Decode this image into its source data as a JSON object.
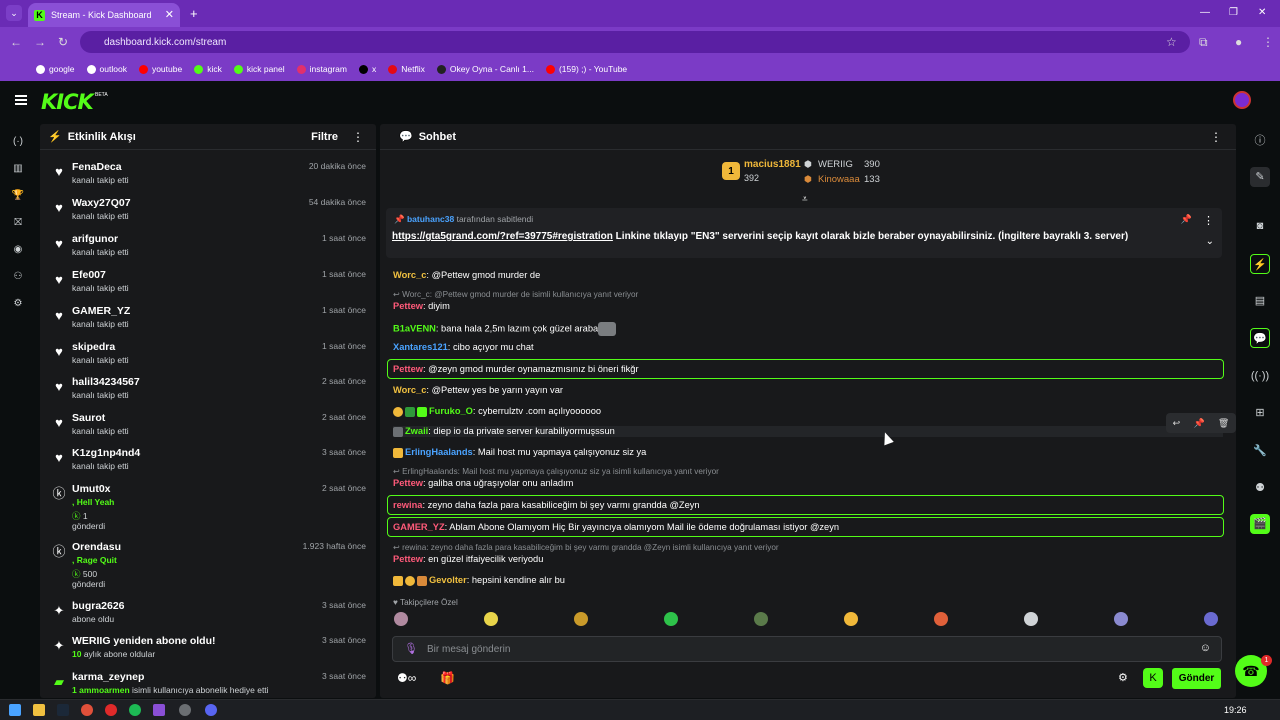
{
  "browser": {
    "tab_title": "Stream - Kick Dashboard",
    "new_tab": "+",
    "url": "dashboard.kick.com/stream",
    "bookmarks": [
      {
        "label": "google",
        "color": "#ffffff"
      },
      {
        "label": "outlook",
        "color": "#ffffff"
      },
      {
        "label": "youtube",
        "color": "#ff0000"
      },
      {
        "label": "kick",
        "color": "#53fc18"
      },
      {
        "label": "kick panel",
        "color": "#53fc18"
      },
      {
        "label": "instagram",
        "color": "#e1306c"
      },
      {
        "label": "x",
        "color": "#000000"
      },
      {
        "label": "Netflix",
        "color": "#e50914"
      },
      {
        "label": "Okey Oyna - Canlı 1...",
        "color": "#222222"
      },
      {
        "label": "(159) ;) - YouTube",
        "color": "#ff0000"
      }
    ]
  },
  "brand": {
    "logo": "KICK",
    "tag": "BETA",
    "accent": "#53fc18"
  },
  "activity": {
    "title": "Etkinlik Akışı",
    "filter_label": "Filtre",
    "items": [
      {
        "user": "FenaDeca",
        "sub": "kanalı takip etti",
        "time": "20 dakika önce",
        "icon": "heart-icon"
      },
      {
        "user": "Waxy27Q07",
        "sub": "kanalı takip etti",
        "time": "54 dakika önce",
        "icon": "heart-icon"
      },
      {
        "user": "arifgunor",
        "sub": "kanalı takip etti",
        "time": "1 saat önce",
        "icon": "heart-icon"
      },
      {
        "user": "Efe007",
        "sub": "kanalı takip etti",
        "time": "1 saat önce",
        "icon": "heart-icon"
      },
      {
        "user": "GAMER_YZ",
        "sub": "kanalı takip etti",
        "time": "1 saat önce",
        "icon": "heart-icon"
      },
      {
        "user": "skipedra",
        "sub": "kanalı takip etti",
        "time": "1 saat önce",
        "icon": "heart-icon"
      },
      {
        "user": "halil34234567",
        "sub": "kanalı takip etti",
        "time": "2 saat önce",
        "icon": "heart-icon"
      },
      {
        "user": "Saurot",
        "sub": "kanalı takip etti",
        "time": "2 saat önce",
        "icon": "heart-icon"
      },
      {
        "user": "K1zg1np4nd4",
        "sub": "kanalı takip etti",
        "time": "3 saat önce",
        "icon": "heart-icon"
      }
    ],
    "kicks": [
      {
        "user": "Umut0x",
        "extra": ", Hell Yeah",
        "amount": "1",
        "sub": "gönderdi",
        "time": "2 saat önce"
      },
      {
        "user": "Orendasu",
        "extra": ", Rage Quit",
        "amount": "500",
        "sub": "gönderdi",
        "time": "1.923 hafta önce"
      }
    ],
    "subs": [
      {
        "user": "bugra2626",
        "sub": "abone oldu",
        "time": "3 saat önce"
      },
      {
        "user": "WERIIG yeniden abone oldu!",
        "sub_green": "10",
        "sub": " aylık abone oldular",
        "time": "3 saat önce"
      },
      {
        "user": "karma_zeynep",
        "sub_green": "1",
        "sub_name": " ammoarmen",
        "sub": " isimli kullanıcıya abonelik hediye etti",
        "time": "3 saat önce"
      }
    ]
  },
  "chat": {
    "title": "Sohbet",
    "leaderboard": {
      "first": {
        "rank": "1",
        "name": "macius1881",
        "count": "392"
      },
      "second": {
        "name": "WERIIG",
        "count": "390"
      },
      "third": {
        "name": "Kinowaaa",
        "count": "133"
      }
    },
    "pinned": {
      "by": "batuhanc38",
      "by_suffix": "tarafından sabitlendi",
      "link": "https://gta5grand.com/?ref=39775#registration",
      "text": " Linkine tıklayıp \"EN3\" serverini seçip kayıt olarak bizle beraber oynayabilirsiniz. (İngiltere bayraklı 3. server)"
    },
    "messages": [
      {
        "user": "Worc_c",
        "color": "#f0c040",
        "text": ": @Pettew gmod murder de"
      },
      {
        "reply": "Worc_c: @Pettew gmod murder de isimli kullanıcıya yanıt veriyor"
      },
      {
        "user": "Pettew",
        "color": "#ff5a7a",
        "text": ": diyim"
      },
      {
        "user": "B1aVENN",
        "color": "#53fc18",
        "text": ": bana hala 2,5m lazım çok güzel araba"
      },
      {
        "user": "Xantares121",
        "color": "#4aa3ff",
        "text": ": cibo açıyor mu chat"
      },
      {
        "user": "Pettew",
        "color": "#ff5a7a",
        "text": ": @zeyn gmod murder oynamazmısınız bi öneri fikğr",
        "hl": true
      },
      {
        "user": "Worc_c",
        "color": "#f0c040",
        "text": ": @Pettew yes be yarın yayın var"
      },
      {
        "user": "Furuko_O",
        "color": "#53fc18",
        "text": ": cyberrulztv .com açılıyoooooo"
      },
      {
        "user": "Zwaii",
        "color": "#53fc18",
        "text": ": diep io da private server kurabiliyormuşssun"
      },
      {
        "user": "ErlingHaalands",
        "color": "#4aa3ff",
        "text": ": Mail host mu yapmaya çalışıyonuz siz ya"
      },
      {
        "reply": "ErlingHaalands: Mail host mu yapmaya çalışıyonuz siz ya isimli kullanıcıya yanıt veriyor"
      },
      {
        "user": "Pettew",
        "color": "#ff5a7a",
        "text": ": galiba ona uğraşıyolar onu anladım"
      },
      {
        "user": "rewina",
        "color": "#ff5a7a",
        "text": ": zeyno daha fazla para kasabiliceğim bi şey varmı grandda @Zeyn",
        "hl": true
      },
      {
        "user": "GAMER_YZ",
        "color": "#ff5a7a",
        "text": ": Ablam Abone Olamıyom Hiç Bir yayıncıya olamıyom Mail ile ödeme doğrulaması istiyor @zeyn",
        "hl": true
      },
      {
        "reply": "rewina: zeyno daha fazla para kasabiliceğim bi şey varmı grandda @Zeyn isimli kullanıcıya yanıt veriyor"
      },
      {
        "user": "Pettew",
        "color": "#ff5a7a",
        "text": ": en güzel itfaiyecilik veriyodu"
      },
      {
        "user": "Gevolter",
        "color": "#f0c040",
        "text": ": hepsini kendine alır bu"
      }
    ],
    "followers_only": "Takipçilere Özel",
    "input_placeholder": "Bir mesaj gönderin",
    "send_label": "Gönder"
  },
  "taskbar": {
    "time": "19:26"
  },
  "fab_badge": "1"
}
